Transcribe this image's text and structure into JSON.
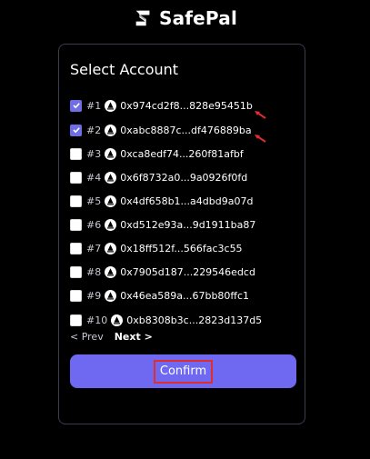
{
  "brand": {
    "name": "SafePal"
  },
  "card": {
    "title": "Select Account"
  },
  "accounts": [
    {
      "index": "#1",
      "address": "0x974cd2f8...828e95451b",
      "checked": true
    },
    {
      "index": "#2",
      "address": "0xabc8887c...df476889ba",
      "checked": true
    },
    {
      "index": "#3",
      "address": "0xca8edf74...260f81afbf",
      "checked": false
    },
    {
      "index": "#4",
      "address": "0x6f8732a0...9a0926f0fd",
      "checked": false
    },
    {
      "index": "#5",
      "address": "0x4df658b1...a4dbd9a07d",
      "checked": false
    },
    {
      "index": "#6",
      "address": "0xd512e93a...9d1911ba87",
      "checked": false
    },
    {
      "index": "#7",
      "address": "0x18ff512f...566fac3c55",
      "checked": false
    },
    {
      "index": "#8",
      "address": "0x7905d187...229546edcd",
      "checked": false
    },
    {
      "index": "#9",
      "address": "0x46ea589a...67bb80ffc1",
      "checked": false
    },
    {
      "index": "#10",
      "address": "0xb8308b3c...2823d137d5",
      "checked": false
    }
  ],
  "pager": {
    "prev_label": "< Prev",
    "next_label": "Next >"
  },
  "confirm": {
    "label": "Confirm"
  },
  "colors": {
    "accent": "#6e69f0",
    "checkbox_on": "#6f6ee7",
    "highlight": "#e02d2d",
    "card_border": "#3b3d4a"
  },
  "icons": {
    "brand": "safepal-logo-icon",
    "account": "account-avatar-icon",
    "check": "checkmark-icon",
    "annotation": "red-arrow-icon"
  }
}
